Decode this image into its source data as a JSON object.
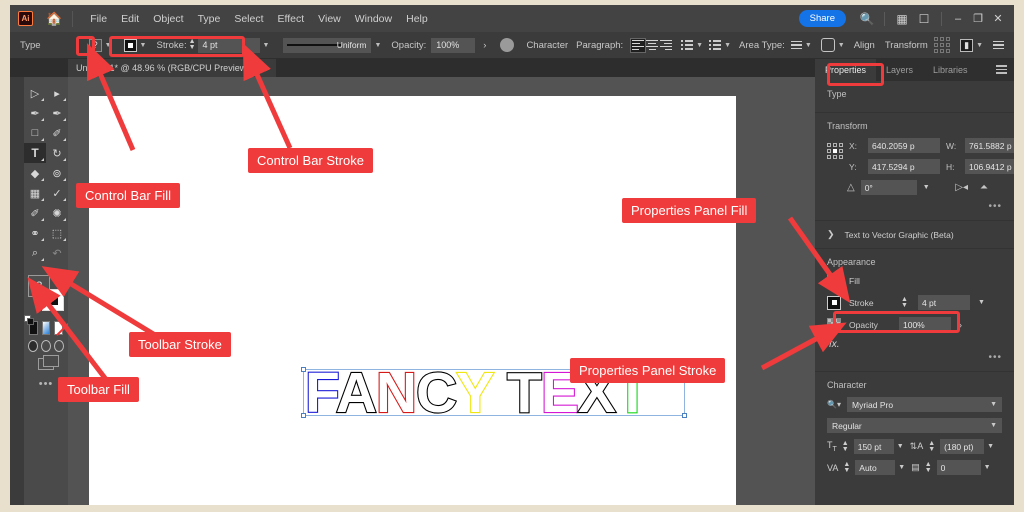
{
  "app": {
    "logo": "Ai",
    "home_icon": "home-icon",
    "menu": [
      "File",
      "Edit",
      "Object",
      "Type",
      "Select",
      "Effect",
      "View",
      "Window",
      "Help"
    ],
    "share_label": "Share",
    "search_icon": "search-icon",
    "arrange_icon": "arrange-documents-icon",
    "workspace_icon": "workspace-switcher-icon",
    "window_minimize": "–",
    "window_restore": "❐",
    "window_close": "✕"
  },
  "control_bar": {
    "context_label": "Type",
    "fill_swatch": "?",
    "fill_caret": "chevron-down-icon",
    "stroke_swatch": "stroke-swatch-icon",
    "stroke_caret": "chevron-down-icon",
    "stroke_label": "Stroke:",
    "stroke_weight": "4 pt",
    "stroke_weight_caret": "chevron-down-icon",
    "profile_label": "Uniform",
    "profile_caret": "chevron-down-icon",
    "opacity_label": "Opacity:",
    "opacity_value": "100%",
    "opacity_more": "›",
    "recolor_icon": "recolor-artwork-icon",
    "character_label": "Character",
    "paragraph_label": "Paragraph:",
    "align_left_icon": "align-left-icon",
    "align_center_icon": "align-center-icon",
    "align_right_icon": "align-right-icon",
    "bullet_list_icon": "bulleted-list-icon",
    "number_list_icon": "numbered-list-icon",
    "area_type_label": "Area Type:",
    "area_type_icon": "area-type-options-icon",
    "wrap_icon": "text-wrap-icon",
    "align_label": "Align",
    "transform_label": "Transform",
    "anchor_icon": "anchor-points-icon",
    "selected_artboard_icon": "artboard-icon",
    "panel_menu_icon": "panel-menu-icon"
  },
  "document": {
    "tab_title": "Untitled-1* @ 48.96 % (RGB/CPU Preview)",
    "tab_close": "×"
  },
  "toolbar": {
    "tools": [
      "selection-tool-icon",
      "direct-selection-tool-icon",
      "pen-tool-icon",
      "curvature-tool-icon",
      "rectangle-tool-icon",
      "paintbrush-tool-icon",
      "type-tool-icon",
      "rotate-tool-icon",
      "eraser-tool-icon",
      "shape-builder-tool-icon",
      "gradient-tool-icon",
      "eyedropper-tool-icon",
      "scale-tool-icon",
      "width-tool-icon",
      "blend-tool-icon",
      "artboard-tool-icon",
      "zoom-tool-icon",
      "undo-icon"
    ],
    "tool_glyphs": [
      "▷",
      "▶",
      "✎",
      "✒",
      "□",
      "╱",
      "T",
      "↻",
      "◆",
      "⊚",
      "▤",
      "✐",
      "⤢",
      "⤳",
      "⚶",
      "⬚",
      "⌕",
      "↶"
    ],
    "selected_tool": "type-tool-icon",
    "fill_swatch_label": "?",
    "stroke_swatch_label": "stroke-swatch-icon",
    "swap_icon": "swap-fill-stroke-icon",
    "default_icon": "default-fill-stroke-icon",
    "color_mode": "color-swatch-icon",
    "gradient_mode": "gradient-swatch-icon",
    "none_mode": "none-swatch-icon",
    "draw_modes": [
      "draw-normal-icon",
      "draw-behind-icon",
      "draw-inside-icon"
    ],
    "screen_mode": "change-screen-mode-icon",
    "more_tools": "•••"
  },
  "artwork": {
    "letters": [
      {
        "char": "F",
        "stroke": "#1a1ad6"
      },
      {
        "char": "A",
        "stroke": "#000000"
      },
      {
        "char": "N",
        "stroke": "#d61a1a"
      },
      {
        "char": "C",
        "stroke": "#000000"
      },
      {
        "char": "Y",
        "stroke": "#f0e614"
      },
      {
        "char": " ",
        "stroke": "#000000"
      },
      {
        "char": "T",
        "stroke": "#000000"
      },
      {
        "char": "E",
        "stroke": "#d417d4"
      },
      {
        "char": "X",
        "stroke": "#000000"
      },
      {
        "char": "T",
        "stroke": "#14d614"
      }
    ],
    "text": "FANCY TEXT",
    "fill_color": "#ffffff"
  },
  "properties": {
    "tabs": [
      {
        "label": "Properties",
        "active": true
      },
      {
        "label": "Layers",
        "active": false
      },
      {
        "label": "Libraries",
        "active": false
      }
    ],
    "type_section": "Type",
    "transform": {
      "title": "Transform",
      "reference_point_icon": "reference-point-icon",
      "x_label": "X:",
      "x_value": "640.2059 p",
      "y_label": "Y:",
      "y_value": "417.5294 p",
      "w_label": "W:",
      "w_value": "761.5882 p",
      "h_label": "H:",
      "h_value": "106.9412 p",
      "lock_ratio_icon": "constrain-proportions-icon",
      "angle_icon": "shear-angle-icon",
      "angle_value": "0°",
      "flip_h_icon": "flip-horizontal-icon",
      "flip_v_icon": "flip-vertical-icon",
      "more_options": "•••"
    },
    "vector_graphic": {
      "expand_icon": "chevron-right-icon",
      "label": "Text to Vector Graphic (Beta)"
    },
    "appearance": {
      "title": "Appearance",
      "fill_swatch": "?",
      "fill_label": "Fill",
      "stroke_swatch": "stroke-swatch-icon",
      "stroke_label": "Stroke",
      "stroke_value": "4 pt",
      "stroke_caret": "chevron-down-icon",
      "opacity_swatch": "opacity-swatch-icon",
      "opacity_label": "Opacity",
      "opacity_value": "100%",
      "opacity_more": "›",
      "fx_label": "fx.",
      "more_options": "•••"
    },
    "character": {
      "title": "Character",
      "search_icon": "search-font-icon",
      "font_family": "Myriad Pro",
      "font_style": "Regular",
      "size_icon": "font-size-icon",
      "size_value": "150 pt",
      "leading_icon": "leading-icon",
      "leading_value": "(180 pt)",
      "kerning_icon": "kerning-icon",
      "kerning_value": "Auto",
      "tracking_icon": "tracking-icon",
      "tracking_value": "0"
    }
  },
  "annotations": [
    {
      "id": "control-bar-fill",
      "label": "Control Bar Fill"
    },
    {
      "id": "control-bar-stroke",
      "label": "Control Bar Stroke"
    },
    {
      "id": "properties-panel-fill",
      "label": "Properties Panel Fill"
    },
    {
      "id": "properties-panel-stroke",
      "label": "Properties Panel Stroke"
    },
    {
      "id": "toolbar-stroke",
      "label": "Toolbar Stroke"
    },
    {
      "id": "toolbar-fill",
      "label": "Toolbar Fill"
    }
  ],
  "colors": {
    "annotation_red": "#ef3b3b",
    "share_blue": "#1473e6",
    "panel_bg": "#3b3b3b",
    "canvas_bg": "#535353"
  }
}
